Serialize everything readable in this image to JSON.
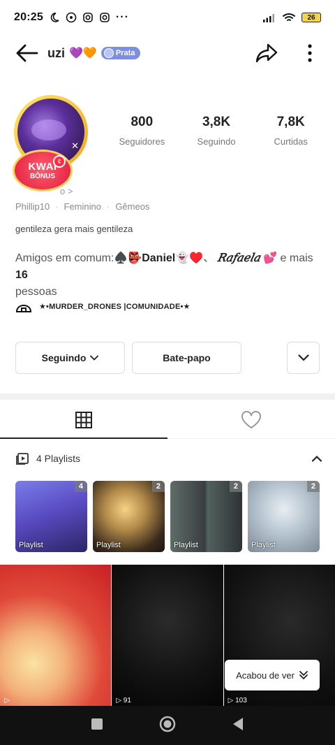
{
  "status_bar": {
    "time": "20:25",
    "battery": "26",
    "icons": [
      "moon-icon",
      "whatsapp-icon",
      "instagram-icon",
      "instagram-icon",
      "more-icon",
      "signal-icon",
      "wifi-icon",
      "battery-icon"
    ]
  },
  "header": {
    "username": "uzi",
    "hearts": [
      "💜",
      "🧡"
    ],
    "badge": "Prata"
  },
  "profile": {
    "kwai_bonus_line1": "KWAI",
    "kwai_bonus_line2": "BÔNUS",
    "id_link": "o >",
    "id_value": "Phillip10",
    "gender": "Feminino",
    "sign": "Gêmeos",
    "bio": "gentileza gera mais gentileza",
    "friends_prefix": "Amigos em comum:♠️👺",
    "friend_1": "Daniel",
    "friend_1_suffix": "👻♥️、",
    "friend_2": "𝑅𝑎𝑓𝑎𝑒𝑙𝑎",
    "friend_2_suffix": "💕",
    "friends_middle": " e mais ",
    "friends_count": "16",
    "friends_end": "pessoas",
    "community": "★•MURDER_DRONES |COMUNIDADE•★"
  },
  "stats": [
    {
      "value": "800",
      "label": "Seguidores"
    },
    {
      "value": "3,8K",
      "label": "Seguindo"
    },
    {
      "value": "7,8K",
      "label": "Curtidas"
    }
  ],
  "actions": {
    "following_label": "Seguindo",
    "chat_label": "Bate-papo"
  },
  "playlists": {
    "header_label": "4 Playlists",
    "items": [
      {
        "label": "Playlist",
        "count": "4"
      },
      {
        "label": "Playlist",
        "count": "2"
      },
      {
        "label": "Playlist",
        "count": "2"
      },
      {
        "label": "Playlist",
        "count": "2"
      }
    ]
  },
  "grid": [
    {
      "views": ""
    },
    {
      "views": "91"
    },
    {
      "views": "103"
    }
  ],
  "toast": {
    "label": "Acabou de ver"
  },
  "colors": {
    "accent_red": "#e01a3c",
    "badge_blue": "#7d8fe0",
    "gold": "#f3a51b"
  }
}
